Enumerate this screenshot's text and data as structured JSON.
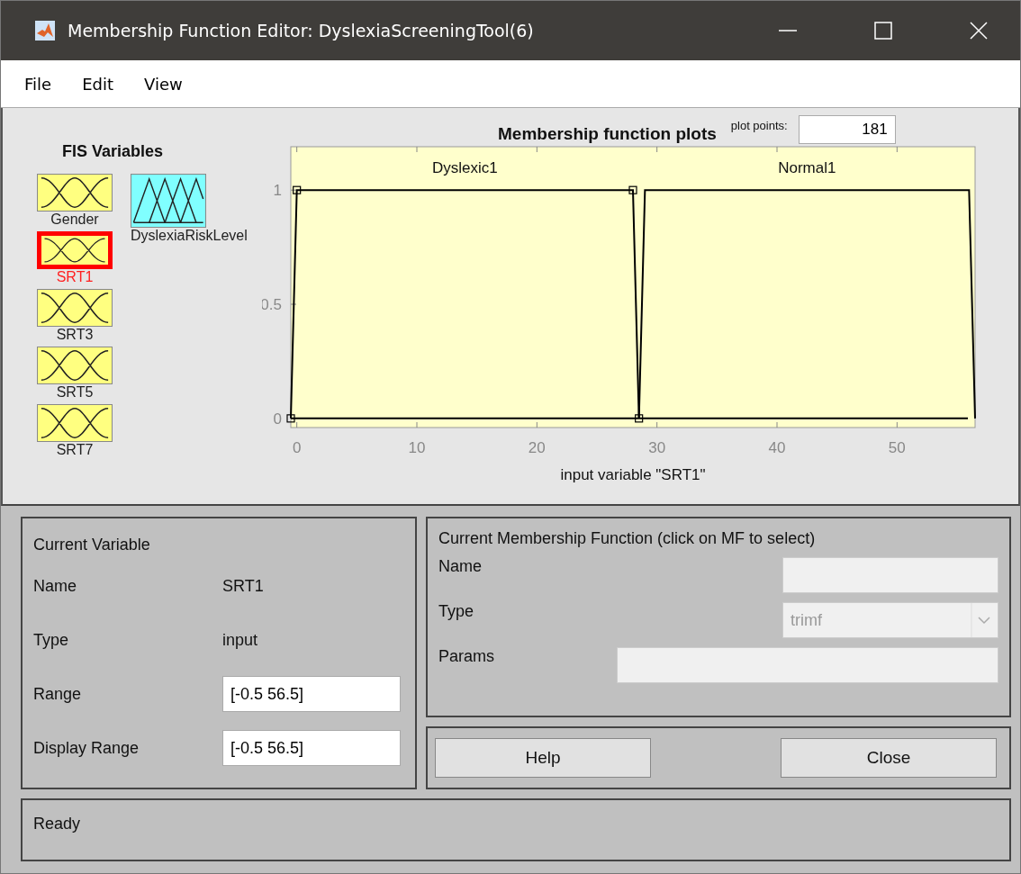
{
  "window": {
    "title": "Membership Function Editor: DyslexiaScreeningTool(6)"
  },
  "menu": [
    "File",
    "Edit",
    "View"
  ],
  "fis_variables": {
    "title": "FIS Variables",
    "items": [
      {
        "name": "Gender",
        "kind": "input",
        "selected": false
      },
      {
        "name": "SRT1",
        "kind": "input",
        "selected": true
      },
      {
        "name": "SRT3",
        "kind": "input",
        "selected": false
      },
      {
        "name": "SRT5",
        "kind": "input",
        "selected": false
      },
      {
        "name": "SRT7",
        "kind": "input",
        "selected": false
      },
      {
        "name": "DyslexiaRiskLevel",
        "kind": "output",
        "selected": false
      }
    ]
  },
  "plot": {
    "plot_points_label": "plot points:",
    "plot_points": "181",
    "chart_data": {
      "type": "line",
      "title": "Membership function plots",
      "xlabel": "input variable \"SRT1\"",
      "x": [
        -0.5,
        0,
        28,
        28.5,
        29,
        56,
        56.5
      ],
      "series": [
        {
          "name": "Dyslexic1",
          "color": "#000000",
          "marker": "square",
          "values": [
            0,
            1,
            1,
            0,
            null,
            null,
            null
          ]
        },
        {
          "name": "Normal1",
          "color": "#000000",
          "values": [
            null,
            null,
            null,
            0,
            1,
            1,
            0
          ]
        }
      ],
      "xlim": [
        -0.5,
        56.5
      ],
      "ylim": [
        -0.04,
        1.19
      ],
      "xticks": [
        0,
        10,
        20,
        30,
        40,
        50
      ],
      "yticks": [
        0,
        0.5,
        1
      ]
    }
  },
  "current_variable": {
    "title": "Current Variable",
    "fields": [
      {
        "label": "Name",
        "value": "SRT1",
        "kind": "text"
      },
      {
        "label": "Type",
        "value": "input",
        "kind": "text"
      },
      {
        "label": "Range",
        "value": "[-0.5 56.5]",
        "kind": "input"
      },
      {
        "label": "Display Range",
        "value": "[-0.5 56.5]",
        "kind": "input"
      }
    ]
  },
  "current_mf": {
    "title": "Current Membership Function (click on MF to select)",
    "name_label": "Name",
    "type_label": "Type",
    "type_value": "trimf",
    "params_label": "Params",
    "disabled": true
  },
  "buttons": [
    "Help",
    "Close"
  ],
  "status": "Ready"
}
